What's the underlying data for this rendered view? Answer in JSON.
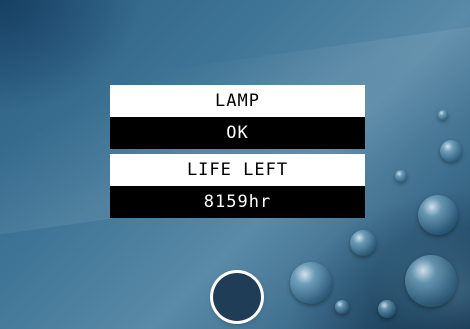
{
  "osd": {
    "lamp_label": "LAMP",
    "lamp_status": "OK",
    "life_label": "LIFE LEFT",
    "life_value": "8159hr"
  },
  "colors": {
    "label_bg": "#ffffff",
    "value_bg": "#000000",
    "button_fill": "#1f3d57"
  }
}
